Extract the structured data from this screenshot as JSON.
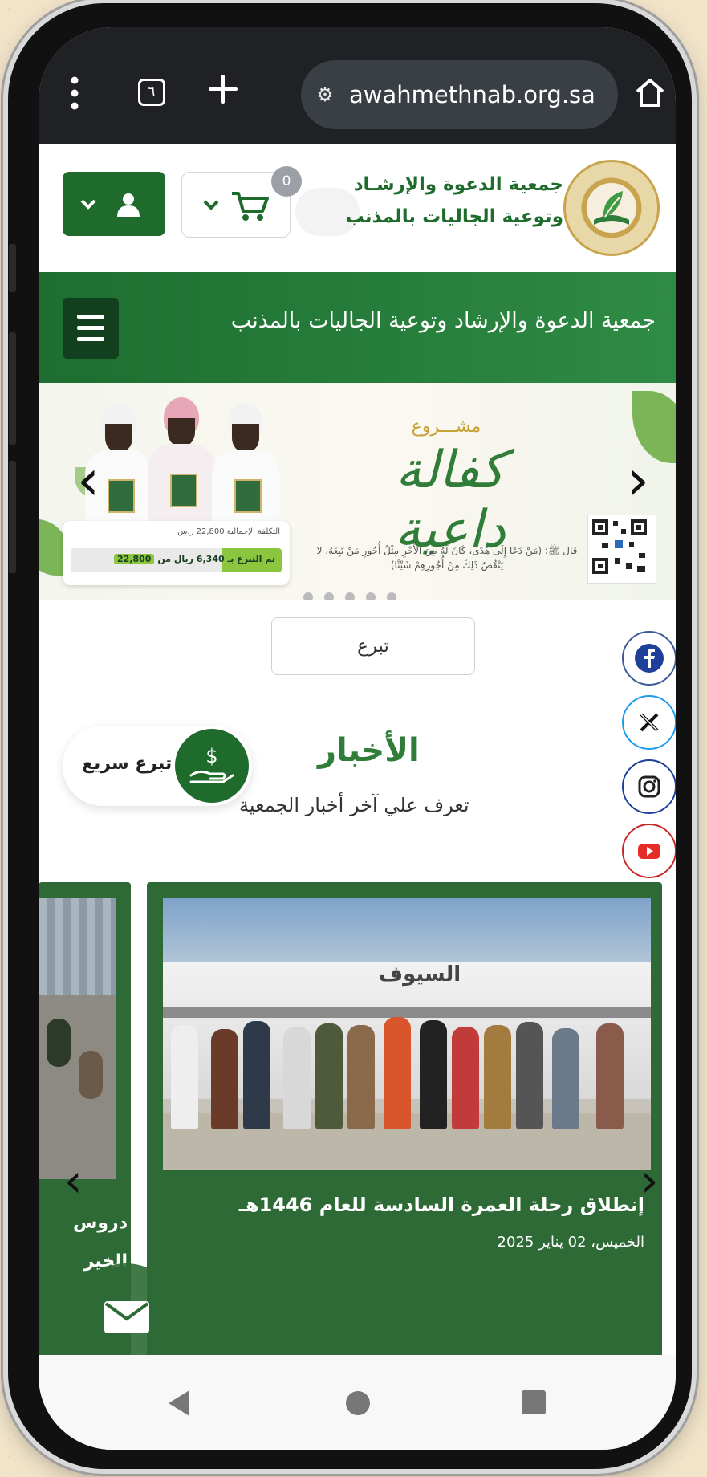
{
  "browser": {
    "tab_count": "٦",
    "url": "awahmethnab.org.sa"
  },
  "header": {
    "org_line1": "جمعية الدعوة والإرشـاد",
    "org_line2": "وتوعية الجاليات بالمذنب",
    "cart_count": "0"
  },
  "nav": {
    "title": "جمعية الدعوة والإرشاد وتوعية الجاليات بالمذنب"
  },
  "banner": {
    "project_label": "مشـــروع",
    "project_name": "كفالة داعية",
    "quote": "قال ﷺ: (مَنْ دَعَا إِلَى هُدًى، كَانَ لَهُ مِنَ الأَجْرِ مِثْلُ أُجُورِ مَنْ تَبِعَهُ، لا يَنْقُصُ ذَلِكَ مِنْ أُجُورِهِمْ شَيْئًا)",
    "total_cost": "التكلفة الإجمالية 22,800 ر.س",
    "donated_text": "تم التبرع بـ 6,340 ريال من",
    "target_amount": "22,800",
    "progress_fraction": 0.28
  },
  "donate_button": "تبرع",
  "quick_donate": "تبرع سريع",
  "news": {
    "title": "الأخبار",
    "subtitle": "تعرف علي آخر أخبار الجمعية",
    "cards": [
      {
        "title": "إنطلاق رحلة العمرة السادسة للعام 1446هـ",
        "date": "الخميس، 02 يناير 2025",
        "bus_text": "السيوف"
      },
      {
        "title_line1": "دروس",
        "title_line2": "الخير"
      }
    ]
  },
  "colors": {
    "brand_green": "#1e6b2c",
    "facebook": "#1877f2",
    "twitter": "#000000",
    "instagram": "#333333",
    "youtube": "#e52d27"
  }
}
